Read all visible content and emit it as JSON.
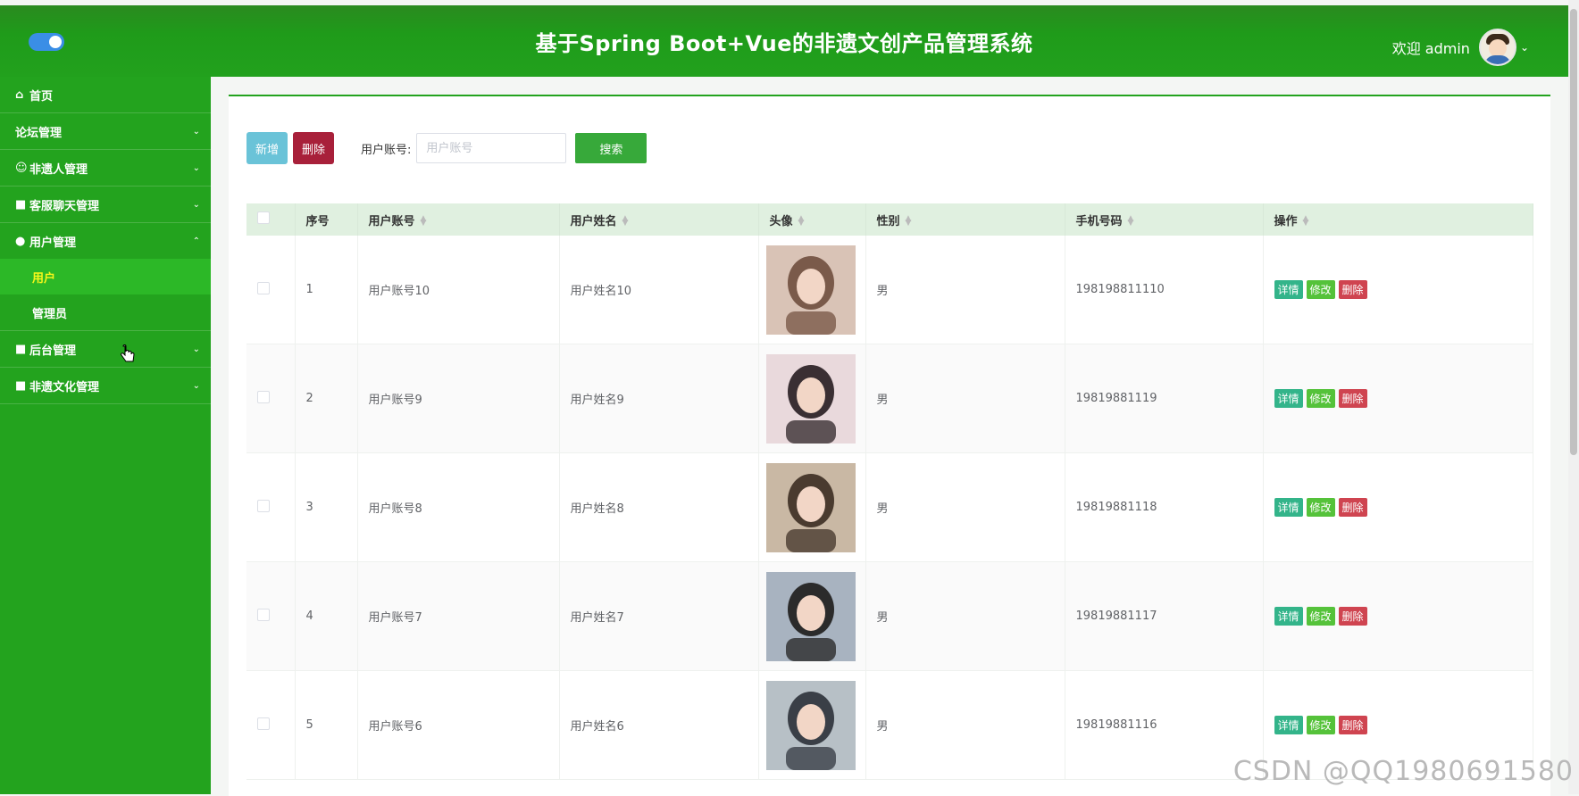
{
  "header": {
    "title": "基于Spring Boot+Vue的非遗文创产品管理系统",
    "welcome": "欢迎 admin"
  },
  "sidebar": {
    "items": [
      {
        "label": "首页",
        "icon": "home-icon"
      },
      {
        "label": "论坛管理",
        "icon": ""
      },
      {
        "label": "非遗人管理",
        "icon": "user-icon"
      },
      {
        "label": "客服聊天管理",
        "icon": "grid-icon"
      },
      {
        "label": "用户管理",
        "icon": "user-filled-icon"
      },
      {
        "label": "后台管理",
        "icon": "grid-icon"
      },
      {
        "label": "非遗文化管理",
        "icon": "grid-icon"
      }
    ],
    "sub_items": [
      {
        "label": "用户",
        "active": true
      },
      {
        "label": "管理员",
        "active": false
      }
    ]
  },
  "toolbar": {
    "add_label": "新增",
    "delete_label": "删除",
    "account_label": "用户账号:",
    "account_placeholder": "用户账号",
    "search_label": "搜索"
  },
  "table": {
    "headers": [
      "序号",
      "用户账号",
      "用户姓名",
      "头像",
      "性别",
      "手机号码",
      "操作"
    ],
    "actions": {
      "detail": "详情",
      "edit": "修改",
      "delete": "删除"
    },
    "rows": [
      {
        "index": "1",
        "account": "用户账号10",
        "name": "用户姓名10",
        "gender": "男",
        "phone": "198198811110"
      },
      {
        "index": "2",
        "account": "用户账号9",
        "name": "用户姓名9",
        "gender": "男",
        "phone": "19819881119"
      },
      {
        "index": "3",
        "account": "用户账号8",
        "name": "用户姓名8",
        "gender": "男",
        "phone": "19819881118"
      },
      {
        "index": "4",
        "account": "用户账号7",
        "name": "用户姓名7",
        "gender": "男",
        "phone": "19819881117"
      },
      {
        "index": "5",
        "account": "用户账号6",
        "name": "用户姓名6",
        "gender": "男",
        "phone": "19819881116"
      }
    ]
  },
  "watermark": "CSDN @QQ1980691580",
  "colors": {
    "header": "#22a11d",
    "sidebar": "#23a31e",
    "active_text": "#f7f71a",
    "add_button": "#6ac3d8",
    "delete_button": "#a8203a",
    "search_button": "#37a93a"
  }
}
